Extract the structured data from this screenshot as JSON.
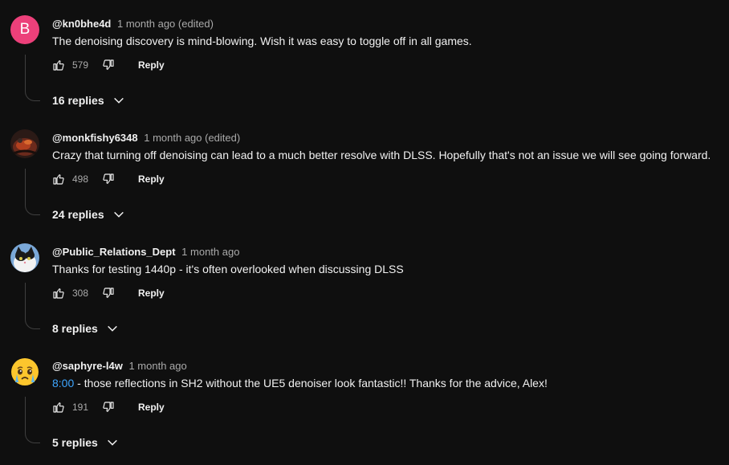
{
  "comments": [
    {
      "author": "@kn0bhe4d",
      "time": "1 month ago (edited)",
      "timestamp_link": "",
      "text": "The denoising discovery is mind-blowing. Wish it was easy to toggle off in all games.",
      "likes": "579",
      "reply_label": "Reply",
      "replies": "16 replies",
      "avatar_letter": "B",
      "avatar_color": "#ec407a"
    },
    {
      "author": "@monkfishy6348",
      "time": "1 month ago (edited)",
      "timestamp_link": "",
      "text": "Crazy that turning off denoising can lead to a much better resolve with DLSS. Hopefully that's not an issue we will see going forward.",
      "likes": "498",
      "reply_label": "Reply",
      "replies": "24 replies"
    },
    {
      "author": "@Public_Relations_Dept",
      "time": "1 month ago",
      "timestamp_link": "",
      "text": "Thanks for testing 1440p - it's often overlooked when discussing DLSS",
      "likes": "308",
      "reply_label": "Reply",
      "replies": "8 replies"
    },
    {
      "author": "@saphyre-l4w",
      "time": "1 month ago",
      "timestamp_link": "8:00",
      "text": " - those reflections in SH2 without the UE5 denoiser look fantastic!! Thanks for the advice, Alex!",
      "likes": "191",
      "reply_label": "Reply",
      "replies": "5 replies"
    }
  ],
  "colors": {
    "background": "#0f0f0f",
    "text": "#f1f1f1",
    "secondary": "#aaaaaa",
    "link": "#3ea6ff"
  }
}
